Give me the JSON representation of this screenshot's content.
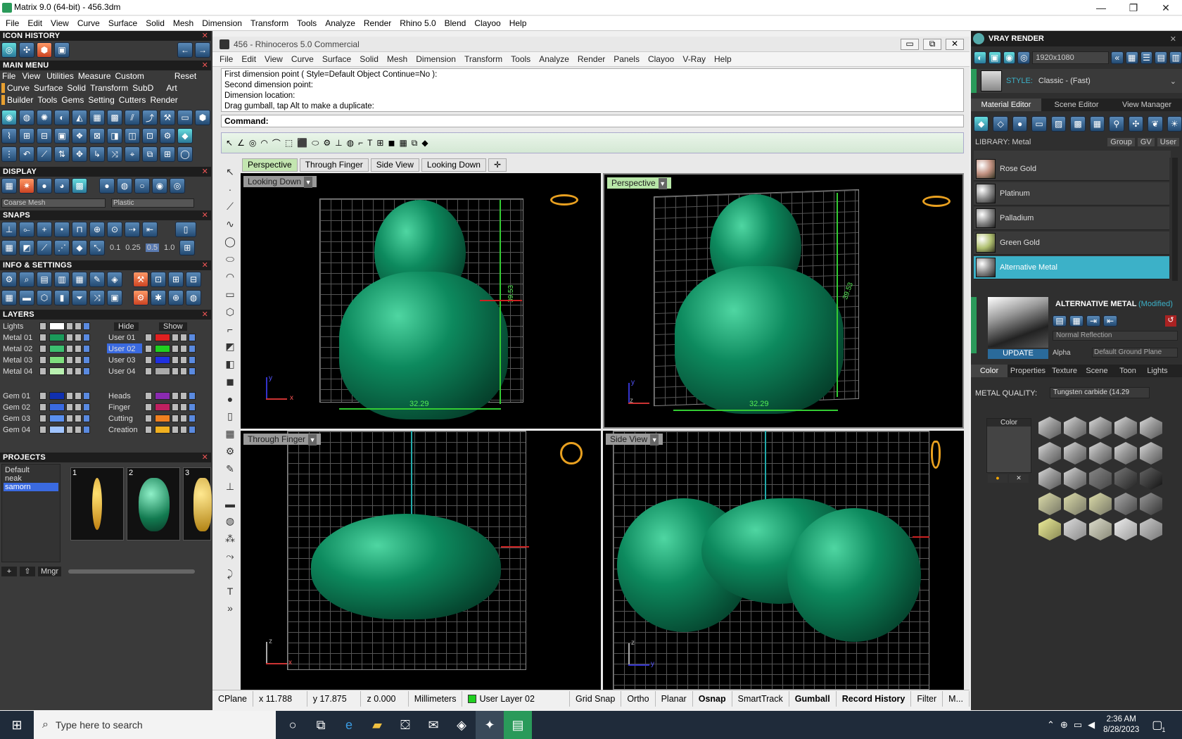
{
  "window": {
    "title": "Matrix 9.0 (64-bit) - 456.3dm",
    "min": "—",
    "max": "❐",
    "close": "✕"
  },
  "menubar": [
    "File",
    "Edit",
    "View",
    "Curve",
    "Surface",
    "Solid",
    "Mesh",
    "Dimension",
    "Transform",
    "Tools",
    "Analyze",
    "Render",
    "Rhino 5.0",
    "Blend",
    "Clayoo",
    "Help"
  ],
  "left": {
    "icon_history": "ICON HISTORY",
    "main_menu": "MAIN MENU",
    "mm_row1": [
      "File",
      "View",
      "Utilities",
      "Measure",
      "Custom",
      "Reset"
    ],
    "mm_row2": [
      "Curve",
      "Surface",
      "Solid",
      "Transform",
      "SubD",
      "Art"
    ],
    "mm_row3": [
      "Builder",
      "Tools",
      "Gems",
      "Setting",
      "Cutters",
      "Render"
    ],
    "display": "DISPLAY",
    "display_mesh": "Coarse Mesh",
    "display_mat": "Plastic",
    "snaps": "SNAPS",
    "snap_vals": [
      "0.1",
      "0.25",
      "0.5",
      "1.0"
    ],
    "info": "INFO & SETTINGS",
    "layers": "LAYERS",
    "lights": "Lights",
    "hide": "Hide",
    "show": "Show",
    "layers_left": [
      {
        "name": "Metal 01",
        "color": "#1a9a5a"
      },
      {
        "name": "Metal 02",
        "color": "#3cc070"
      },
      {
        "name": "Metal 03",
        "color": "#7ee07e"
      },
      {
        "name": "Metal 04",
        "color": "#b8f0b0"
      }
    ],
    "layers_right": [
      {
        "name": "User 01",
        "color": "#e02020"
      },
      {
        "name": "User 02",
        "color": "#20d020"
      },
      {
        "name": "User 03",
        "color": "#2030e0"
      },
      {
        "name": "User 04",
        "color": "#aaaaaa"
      }
    ],
    "gems_left": [
      {
        "name": "Gem 01",
        "color": "#1030b0"
      },
      {
        "name": "Gem 02",
        "color": "#3a6ae0"
      },
      {
        "name": "Gem 03",
        "color": "#5a90f0"
      },
      {
        "name": "Gem 04",
        "color": "#a0c4ff"
      }
    ],
    "gems_right": [
      {
        "name": "Heads",
        "color": "#8a2ab0"
      },
      {
        "name": "Finger",
        "color": "#c02060"
      },
      {
        "name": "Cutting",
        "color": "#f08020"
      },
      {
        "name": "Creation",
        "color": "#f0b020"
      }
    ],
    "projects": "PROJECTS",
    "project_list": [
      "Default",
      "neak",
      "samorn"
    ],
    "thumbs": [
      "1",
      "2",
      "3"
    ],
    "mngr": "Mngr"
  },
  "inner": {
    "title": "456 - Rhinoceros 5.0 Commercial",
    "menu": [
      "File",
      "Edit",
      "View",
      "Curve",
      "Surface",
      "Solid",
      "Mesh",
      "Dimension",
      "Transform",
      "Tools",
      "Analyze",
      "Render",
      "Panels",
      "Clayoo",
      "V-Ray",
      "Help"
    ],
    "history": [
      "First dimension point ( Style=Default  Object  Continue=No ):",
      "Second dimension point:",
      "Dimension location:",
      "Drag gumball, tap Alt to make a duplicate:"
    ],
    "command": "Command:",
    "tabs": [
      "Perspective",
      "Through Finger",
      "Side View",
      "Looking Down"
    ],
    "tab_add": "✛"
  },
  "viewports": {
    "tl": {
      "label": "Looking Down",
      "dim_w": "32.29",
      "dim_h": "39.53"
    },
    "tr": {
      "label": "Perspective",
      "dim_w": "32.29",
      "dim_h": "39.53"
    },
    "bl": {
      "label": "Through Finger"
    },
    "br": {
      "label": "Side View"
    },
    "axis_x": "x",
    "axis_y": "y",
    "axis_z": "z"
  },
  "status": [
    "CPlane",
    "x 11.788",
    "y 17.875",
    "z 0.000",
    "Millimeters",
    "User Layer 02",
    "Grid Snap",
    "Ortho",
    "Planar",
    "Osnap",
    "SmartTrack",
    "Gumball",
    "Record History",
    "Filter",
    "M..."
  ],
  "status_bold": [
    "Osnap",
    "Gumball",
    "Record History"
  ],
  "right": {
    "title": "VRAY RENDER",
    "resolution": "1920x1080",
    "style_label": "STYLE:",
    "style_value": "Classic - (Fast)",
    "tabs": [
      "Material Editor",
      "Scene Editor",
      "View Manager"
    ],
    "library": "LIBRARY: Metal",
    "group": "Group",
    "gv": "GV",
    "user": "User",
    "materials": [
      "Rose Gold",
      "Platinum",
      "Palladium",
      "Green Gold",
      "Alternative Metal"
    ],
    "selected_mat": "ALTERNATIVE METAL",
    "modified": "(Modified)",
    "reflection": "Normal Reflection",
    "update": "UPDATE",
    "alpha": "Alpha",
    "ground": "Default Ground Plane",
    "subtabs": [
      "Color",
      "Properties",
      "Texture",
      "Scene",
      "Toon",
      "Lights"
    ],
    "quality_label": "METAL QUALITY:",
    "quality_value": "Tungsten carbide (14.29",
    "color_label": "Color"
  },
  "taskbar": {
    "search": "Type here to search",
    "time": "2:36 AM",
    "date": "8/28/2023",
    "badge": "1"
  }
}
